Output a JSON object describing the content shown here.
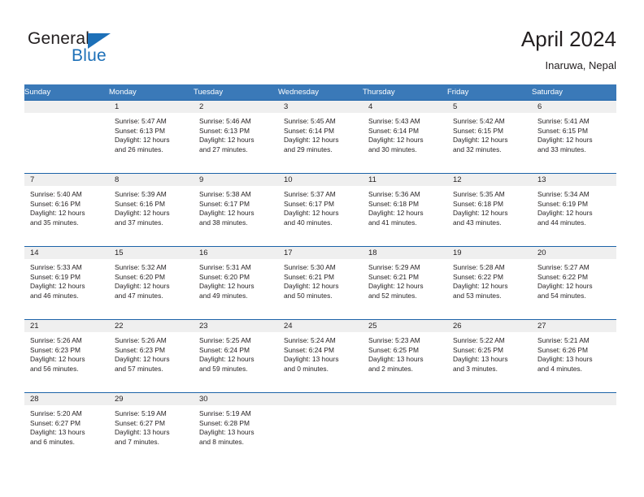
{
  "brand": {
    "name_top": "General",
    "name_bottom": "Blue",
    "logo_icon": "blue-triangle-logo",
    "accent_color": "#1d70b8"
  },
  "header": {
    "title": "April 2024",
    "subtitle": "Inaruwa, Nepal"
  },
  "colors": {
    "header_row_bg": "#3a79b8",
    "row_divider": "#1c63a8",
    "daynum_band_bg": "#efefef",
    "text": "#231f20"
  },
  "weekday_headers": [
    "Sunday",
    "Monday",
    "Tuesday",
    "Wednesday",
    "Thursday",
    "Friday",
    "Saturday"
  ],
  "weeks": [
    [
      {
        "day": "",
        "lines": []
      },
      {
        "day": "1",
        "lines": [
          "Sunrise: 5:47 AM",
          "Sunset: 6:13 PM",
          "Daylight: 12 hours",
          "and 26 minutes."
        ]
      },
      {
        "day": "2",
        "lines": [
          "Sunrise: 5:46 AM",
          "Sunset: 6:13 PM",
          "Daylight: 12 hours",
          "and 27 minutes."
        ]
      },
      {
        "day": "3",
        "lines": [
          "Sunrise: 5:45 AM",
          "Sunset: 6:14 PM",
          "Daylight: 12 hours",
          "and 29 minutes."
        ]
      },
      {
        "day": "4",
        "lines": [
          "Sunrise: 5:43 AM",
          "Sunset: 6:14 PM",
          "Daylight: 12 hours",
          "and 30 minutes."
        ]
      },
      {
        "day": "5",
        "lines": [
          "Sunrise: 5:42 AM",
          "Sunset: 6:15 PM",
          "Daylight: 12 hours",
          "and 32 minutes."
        ]
      },
      {
        "day": "6",
        "lines": [
          "Sunrise: 5:41 AM",
          "Sunset: 6:15 PM",
          "Daylight: 12 hours",
          "and 33 minutes."
        ]
      }
    ],
    [
      {
        "day": "7",
        "lines": [
          "Sunrise: 5:40 AM",
          "Sunset: 6:16 PM",
          "Daylight: 12 hours",
          "and 35 minutes."
        ]
      },
      {
        "day": "8",
        "lines": [
          "Sunrise: 5:39 AM",
          "Sunset: 6:16 PM",
          "Daylight: 12 hours",
          "and 37 minutes."
        ]
      },
      {
        "day": "9",
        "lines": [
          "Sunrise: 5:38 AM",
          "Sunset: 6:17 PM",
          "Daylight: 12 hours",
          "and 38 minutes."
        ]
      },
      {
        "day": "10",
        "lines": [
          "Sunrise: 5:37 AM",
          "Sunset: 6:17 PM",
          "Daylight: 12 hours",
          "and 40 minutes."
        ]
      },
      {
        "day": "11",
        "lines": [
          "Sunrise: 5:36 AM",
          "Sunset: 6:18 PM",
          "Daylight: 12 hours",
          "and 41 minutes."
        ]
      },
      {
        "day": "12",
        "lines": [
          "Sunrise: 5:35 AM",
          "Sunset: 6:18 PM",
          "Daylight: 12 hours",
          "and 43 minutes."
        ]
      },
      {
        "day": "13",
        "lines": [
          "Sunrise: 5:34 AM",
          "Sunset: 6:19 PM",
          "Daylight: 12 hours",
          "and 44 minutes."
        ]
      }
    ],
    [
      {
        "day": "14",
        "lines": [
          "Sunrise: 5:33 AM",
          "Sunset: 6:19 PM",
          "Daylight: 12 hours",
          "and 46 minutes."
        ]
      },
      {
        "day": "15",
        "lines": [
          "Sunrise: 5:32 AM",
          "Sunset: 6:20 PM",
          "Daylight: 12 hours",
          "and 47 minutes."
        ]
      },
      {
        "day": "16",
        "lines": [
          "Sunrise: 5:31 AM",
          "Sunset: 6:20 PM",
          "Daylight: 12 hours",
          "and 49 minutes."
        ]
      },
      {
        "day": "17",
        "lines": [
          "Sunrise: 5:30 AM",
          "Sunset: 6:21 PM",
          "Daylight: 12 hours",
          "and 50 minutes."
        ]
      },
      {
        "day": "18",
        "lines": [
          "Sunrise: 5:29 AM",
          "Sunset: 6:21 PM",
          "Daylight: 12 hours",
          "and 52 minutes."
        ]
      },
      {
        "day": "19",
        "lines": [
          "Sunrise: 5:28 AM",
          "Sunset: 6:22 PM",
          "Daylight: 12 hours",
          "and 53 minutes."
        ]
      },
      {
        "day": "20",
        "lines": [
          "Sunrise: 5:27 AM",
          "Sunset: 6:22 PM",
          "Daylight: 12 hours",
          "and 54 minutes."
        ]
      }
    ],
    [
      {
        "day": "21",
        "lines": [
          "Sunrise: 5:26 AM",
          "Sunset: 6:23 PM",
          "Daylight: 12 hours",
          "and 56 minutes."
        ]
      },
      {
        "day": "22",
        "lines": [
          "Sunrise: 5:26 AM",
          "Sunset: 6:23 PM",
          "Daylight: 12 hours",
          "and 57 minutes."
        ]
      },
      {
        "day": "23",
        "lines": [
          "Sunrise: 5:25 AM",
          "Sunset: 6:24 PM",
          "Daylight: 12 hours",
          "and 59 minutes."
        ]
      },
      {
        "day": "24",
        "lines": [
          "Sunrise: 5:24 AM",
          "Sunset: 6:24 PM",
          "Daylight: 13 hours",
          "and 0 minutes."
        ]
      },
      {
        "day": "25",
        "lines": [
          "Sunrise: 5:23 AM",
          "Sunset: 6:25 PM",
          "Daylight: 13 hours",
          "and 2 minutes."
        ]
      },
      {
        "day": "26",
        "lines": [
          "Sunrise: 5:22 AM",
          "Sunset: 6:25 PM",
          "Daylight: 13 hours",
          "and 3 minutes."
        ]
      },
      {
        "day": "27",
        "lines": [
          "Sunrise: 5:21 AM",
          "Sunset: 6:26 PM",
          "Daylight: 13 hours",
          "and 4 minutes."
        ]
      }
    ],
    [
      {
        "day": "28",
        "lines": [
          "Sunrise: 5:20 AM",
          "Sunset: 6:27 PM",
          "Daylight: 13 hours",
          "and 6 minutes."
        ]
      },
      {
        "day": "29",
        "lines": [
          "Sunrise: 5:19 AM",
          "Sunset: 6:27 PM",
          "Daylight: 13 hours",
          "and 7 minutes."
        ]
      },
      {
        "day": "30",
        "lines": [
          "Sunrise: 5:19 AM",
          "Sunset: 6:28 PM",
          "Daylight: 13 hours",
          "and 8 minutes."
        ]
      },
      {
        "day": "",
        "lines": []
      },
      {
        "day": "",
        "lines": []
      },
      {
        "day": "",
        "lines": []
      },
      {
        "day": "",
        "lines": []
      }
    ]
  ]
}
